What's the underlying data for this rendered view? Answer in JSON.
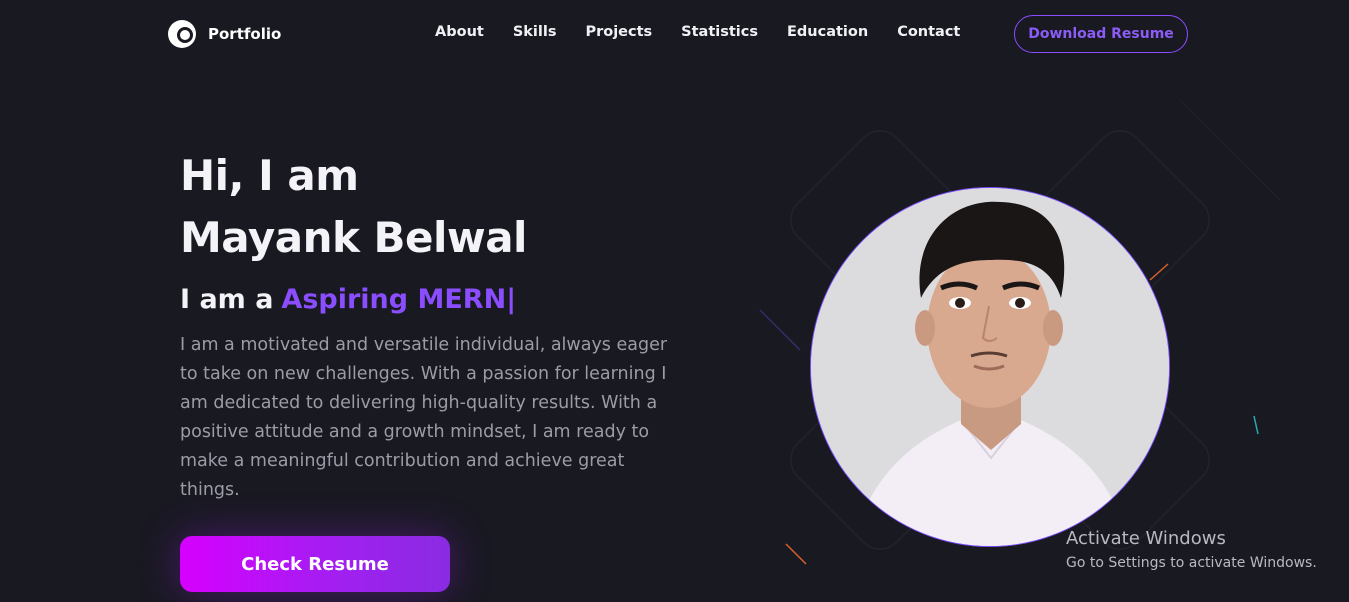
{
  "nav": {
    "logo_text": "Portfolio",
    "links": [
      "About",
      "Skills",
      "Projects",
      "Statistics",
      "Education",
      "Contact"
    ],
    "download_label": "Download Resume"
  },
  "hero": {
    "greeting": "Hi, I am",
    "name": "Mayank Belwal",
    "role_prefix": "I am a",
    "role_typed": "Aspiring MERN",
    "role_cursor": "|",
    "bio": "I am a motivated and versatile individual, always eager to take on new challenges. With a passion for learning I am dedicated to delivering high-quality results. With a positive attitude and a growth mindset, I am ready to make a meaningful contribution and achieve great things.",
    "cta_label": "Check Resume"
  },
  "watermark": {
    "title": "Activate Windows",
    "subtitle": "Go to Settings to activate Windows."
  },
  "colors": {
    "background": "#191922",
    "accent": "#8a4dff",
    "cta_start": "#d600ff",
    "cta_end": "#8a2be2",
    "body_text": "#9d9ca6"
  },
  "icons": [
    "portfolio-logo-icon",
    "profile-photo"
  ]
}
